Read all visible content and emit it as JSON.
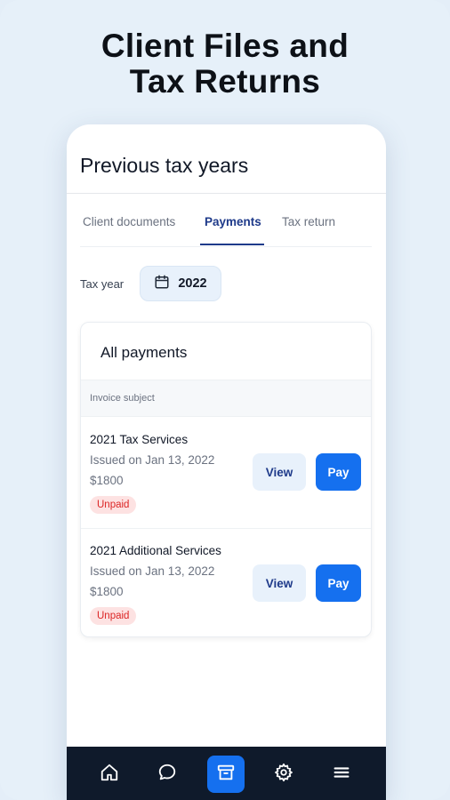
{
  "headline": {
    "line1": "Client Files and",
    "line2": "Tax Returns"
  },
  "screen": {
    "title": "Previous tax years"
  },
  "tabs": [
    {
      "label": "Client documents",
      "active": false
    },
    {
      "label": "Payments",
      "active": true
    },
    {
      "label": "Tax return",
      "active": false
    }
  ],
  "filter": {
    "tax_year_label": "Tax year",
    "selected_year": "2022",
    "icon": "calendar-icon"
  },
  "payments_card": {
    "title": "All payments",
    "column_header": "Invoice subject",
    "rows": [
      {
        "subject": "2021 Tax Services",
        "issued": "Issued on Jan 13, 2022",
        "amount": "$1800",
        "status": "Unpaid",
        "view_label": "View",
        "pay_label": "Pay"
      },
      {
        "subject": "2021 Additional Services",
        "issued": "Issued on Jan 13, 2022",
        "amount": "$1800",
        "status": "Unpaid",
        "view_label": "View",
        "pay_label": "Pay"
      }
    ]
  },
  "bottom_nav": {
    "items": [
      {
        "icon": "home-icon",
        "active": false
      },
      {
        "icon": "chat-icon",
        "active": false
      },
      {
        "icon": "archive-icon",
        "active": true
      },
      {
        "icon": "gear-icon",
        "active": false
      },
      {
        "icon": "menu-icon",
        "active": false
      }
    ]
  },
  "colors": {
    "background": "#e6f0f9",
    "accent": "#1570ef",
    "nav_bg": "#0f1a2b",
    "unpaid_text": "#dc2626",
    "unpaid_bg": "#fde2e2"
  }
}
